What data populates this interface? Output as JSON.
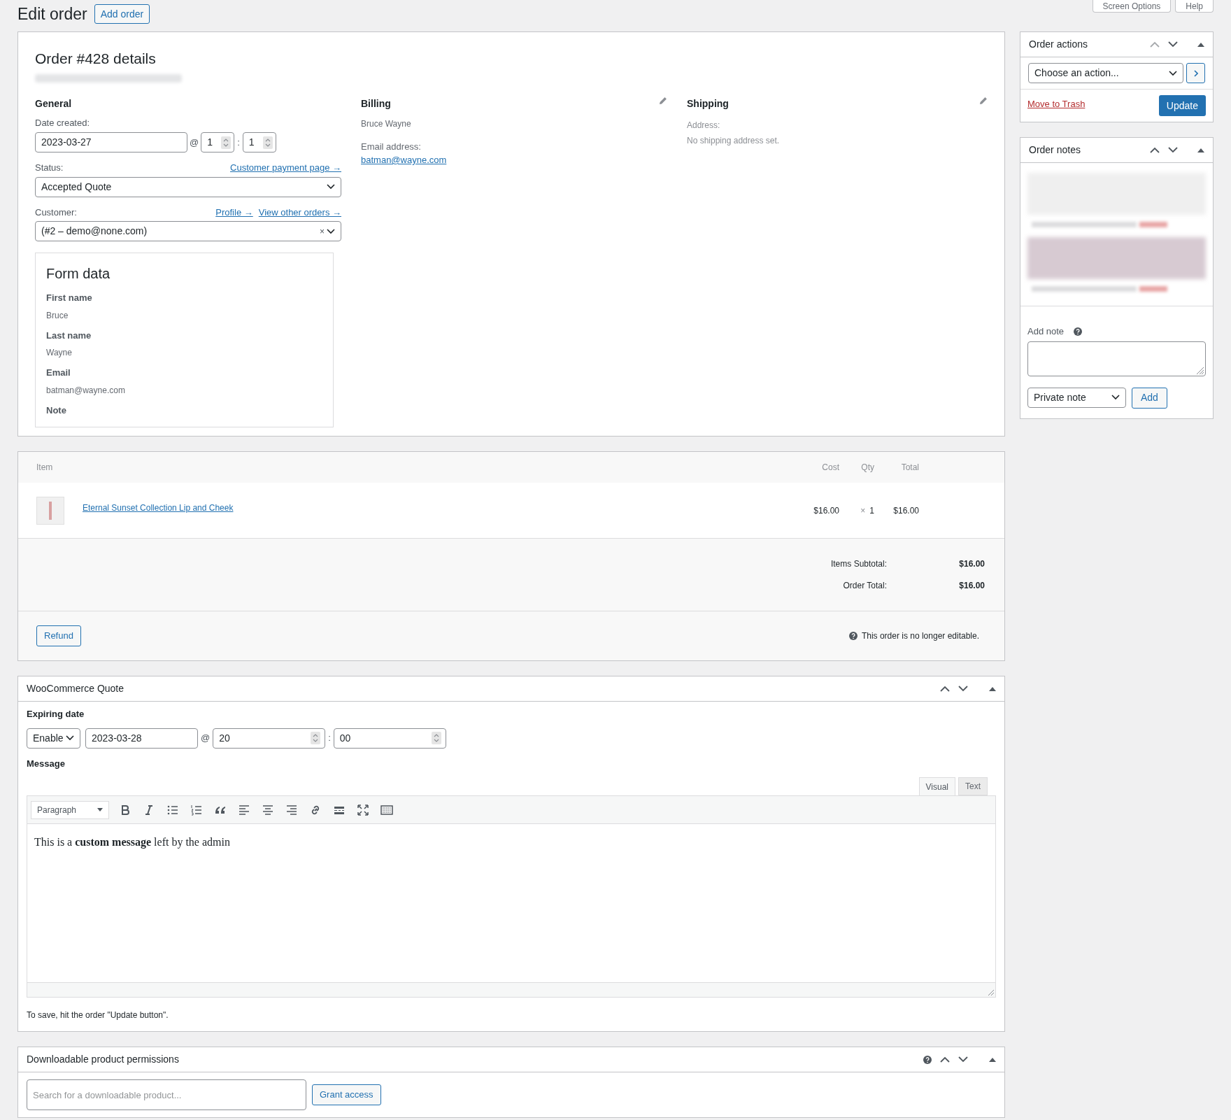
{
  "header": {
    "title": "Edit order",
    "add_button": "Add order",
    "top_buttons": [
      "Screen Options",
      "Help"
    ]
  },
  "order": {
    "title": "Order #428 details",
    "general": {
      "heading": "General",
      "date_label": "Date created:",
      "date": "2023-03-27",
      "at": "@",
      "hour": "1",
      "colon": ":",
      "minute": "1",
      "status_label": "Status:",
      "status_link": "Customer payment page →",
      "status": "Accepted Quote",
      "customer_label": "Customer:",
      "customer_links": [
        "Profile →",
        "View other orders →"
      ],
      "customer": "(#2 – demo@none.com)",
      "clear": "×"
    },
    "billing": {
      "heading": "Billing",
      "name": "Bruce Wayne",
      "email_label": "Email address:",
      "email": "batman@wayne.com"
    },
    "shipping": {
      "heading": "Shipping",
      "address_label": "Address:",
      "address": "No shipping address set."
    },
    "form_data": {
      "title": "Form data",
      "fields": [
        {
          "label": "First name",
          "value": "Bruce"
        },
        {
          "label": "Last name",
          "value": "Wayne"
        },
        {
          "label": "Email",
          "value": "batman@wayne.com"
        },
        {
          "label": "Note"
        }
      ]
    }
  },
  "items": {
    "columns": [
      "Item",
      "Cost",
      "Qty",
      "Total"
    ],
    "rows": [
      {
        "name": "Eternal Sunset Collection Lip and Cheek",
        "cost": "$16.00",
        "qty_sign": "×",
        "qty": "1",
        "total": "$16.00"
      }
    ],
    "totals": [
      {
        "label": "Items Subtotal:",
        "value": "$16.00"
      },
      {
        "label": "Order Total:",
        "value": "$16.00"
      }
    ],
    "refund_button": "Refund",
    "notice": "This order is no longer editable."
  },
  "quote": {
    "title": "WooCommerce Quote",
    "expiring_label": "Expiring date",
    "enable": "Enable",
    "date": "2023-03-28",
    "at": "@",
    "hour": "20",
    "colon": ":",
    "minute": "00",
    "message_label": "Message",
    "editor_tabs": [
      {
        "label": "Visual",
        "selected": true
      },
      {
        "label": "Text",
        "selected": false
      }
    ],
    "format": "Paragraph",
    "content": "This is a **custom message** left by the admin",
    "hint": "To save, hit the order \"Update button\"."
  },
  "downloads": {
    "title": "Downloadable product permissions",
    "search": {
      "placeholder": "Search for a downloadable product..."
    },
    "grant_button": "Grant access"
  },
  "order_actions": {
    "title": "Order actions",
    "action": "Choose an action...",
    "trash": "Move to Trash",
    "update": "Update"
  },
  "order_notes": {
    "title": "Order notes",
    "notes": [
      {
        "kind": "system"
      },
      {
        "kind": "customer"
      }
    ],
    "add_label": "Add note",
    "note_type": "Private note",
    "add_button": "Add"
  }
}
